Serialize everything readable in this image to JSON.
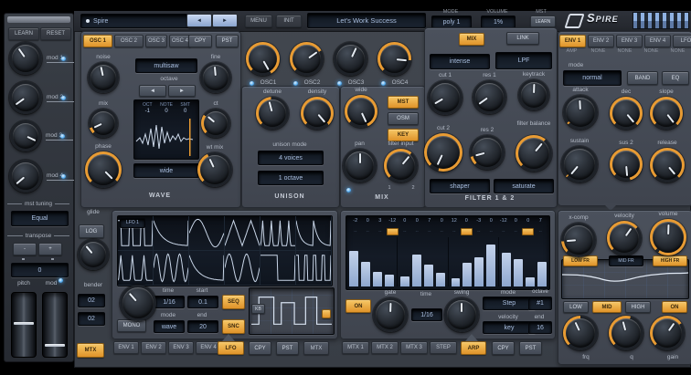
{
  "topbar": {
    "device_label": "Spire",
    "prev": "◄",
    "next": "►",
    "menu": "MENU",
    "init": "INIT",
    "preset_name": "Let's Work Success",
    "mode_label": "MODE",
    "mode_value": "poly 1",
    "volume_label": "VOLUME",
    "volume_value": "1%",
    "mst_label": "MST",
    "mst_button": "LEARN",
    "logo_text": "Spire"
  },
  "sidebar": {
    "learn_button": "LEARN",
    "reset_button": "RESET",
    "mod_knobs": [
      "mod 1",
      "mod 2",
      "mod 3",
      "mod 4"
    ],
    "mst_tuning_label": "mst tuning",
    "mst_tuning_value": "Equal",
    "transpose_label": "transpose",
    "transpose_value": "0",
    "transpose_minus": "-",
    "transpose_plus": "+",
    "pitch_label": "pitch",
    "mod_label": "mod"
  },
  "osc": {
    "tabs": [
      "OSC 1",
      "OSC 2",
      "OSC 3",
      "OSC 4"
    ],
    "copy": "CPY",
    "paste": "PST",
    "mode_value": "multisaw",
    "octave_label": "octave",
    "octave_down": "◄",
    "octave_up": "►",
    "knobs": {
      "noise": "noise",
      "fine": "fine",
      "mix": "mix",
      "ct": "ct",
      "phase": "phase",
      "wt_mix": "wt mix"
    },
    "wave_header": [
      "OCT",
      "NOTE",
      "SMT"
    ],
    "wave_values": [
      "-1",
      "0",
      "0"
    ],
    "wave_name": "wide",
    "section_label": "WAVE"
  },
  "mixer": {
    "knobs": [
      "OSC1",
      "OSC2",
      "OSC3",
      "OSC4"
    ]
  },
  "unison": {
    "knobs": {
      "detune": "detune",
      "density": "density"
    },
    "mode_label": "unison mode",
    "voices_value": "4 voices",
    "octave_value": "1 octave",
    "section_label": "UNISON"
  },
  "mix": {
    "knobs": {
      "wide": "wide",
      "pan": "pan",
      "filter_input": "filter input"
    },
    "buttons": [
      "MST",
      "OSM",
      "KEY"
    ],
    "input_marks": [
      "1",
      "2"
    ],
    "section_label": "MIX"
  },
  "filter": {
    "mix_button": "MIX",
    "link_button": "LINK",
    "mode_value": "intense",
    "type_value": "LPF",
    "knobs": {
      "cut1": "cut 1",
      "res1": "res 1",
      "keytrack": "keytrack",
      "cut2": "cut 2",
      "res2": "res 2",
      "balance": "filter balance"
    },
    "shaper_value": "shaper",
    "saturate_value": "saturate",
    "section_label": "FILTER 1 & 2"
  },
  "env": {
    "tabs": [
      "ENV 1",
      "ENV 2",
      "ENV 3",
      "ENV 4",
      "LFO"
    ],
    "sub_labels": [
      "AMP",
      "NONE",
      "NONE",
      "NONE",
      "NONE"
    ],
    "mode_label": "mode",
    "mode_value": "normal",
    "band_button": "BAND",
    "eq_button": "EQ",
    "knobs": {
      "attack": "attack",
      "decay": "dec",
      "slope": "slope",
      "sustain": "sustain",
      "sus2": "sus 2",
      "release": "release"
    }
  },
  "glide": {
    "label": "glide",
    "log_button": "LOG",
    "bender_label": "bender",
    "bender_values": [
      "02",
      "02"
    ],
    "mtx_button": "MTX"
  },
  "lfo": {
    "display_label": "LFO 1",
    "shapes": [
      "pulse-3",
      "decay-1",
      "sine-1",
      "tri-2",
      "spike-4",
      "decay-2",
      "spike-3",
      "sine-3",
      "decay-1",
      "sine-2",
      "square-1",
      "pulse-4"
    ],
    "mono_button": "MONO",
    "time_label": "time",
    "time_value": "1/16",
    "start_label": "start",
    "start_value": "0.1",
    "mode_label": "mode",
    "mode_value": "wave",
    "end_label": "end",
    "end_value": "20",
    "seq_button": "SEQ",
    "snc_button": "SNC",
    "kb_button": "KB",
    "tabs": [
      "ENV 1",
      "ENV 2",
      "ENV 3",
      "ENV 4"
    ],
    "active_tab": "LFO",
    "copy": "CPY",
    "paste": "PST",
    "mtx_tab": "MTX"
  },
  "arp": {
    "step_values": [
      "-2",
      "0",
      "3",
      "-12",
      "0",
      "0",
      "7",
      "0",
      "12",
      "0",
      "-3",
      "0",
      "-12",
      "0",
      "0",
      "7"
    ],
    "marker_steps": [
      4,
      10,
      15
    ],
    "bars": [
      72,
      50,
      30,
      25,
      20,
      65,
      45,
      28,
      16,
      48,
      60,
      85,
      68,
      55,
      18,
      50
    ],
    "on_button": "ON",
    "gate_label": "gate",
    "time_label": "time",
    "time_value": "1/16",
    "swing_label": "swing",
    "mode_label": "mode",
    "mode_value": "Step",
    "octave_label": "octave",
    "octave_value": "#1",
    "velocity_label": "velocity",
    "velocity_value": "key",
    "end_label": "end",
    "end_value": "16",
    "tabs": [
      "MTX 1",
      "MTX 2",
      "MTX 3",
      "STEP"
    ],
    "active_tab": "ARP",
    "copy": "CPY",
    "paste": "PST"
  },
  "eq": {
    "knobs_top": {
      "xcomp": "x-comp",
      "velocity": "velocity",
      "volume": "volume"
    },
    "band_low": "LOW FR",
    "band_mid": "MID FR",
    "band_high": "HIGH FR",
    "buttons": [
      "LOW",
      "MID",
      "HIGH",
      "ON"
    ],
    "knobs_bottom": {
      "frq": "frq",
      "q": "q",
      "gain": "gain"
    }
  },
  "colors": {
    "accent": "#e89b33",
    "display_text": "#a9bedf",
    "bar": "#8ea7cf",
    "led": "#57aef0"
  }
}
